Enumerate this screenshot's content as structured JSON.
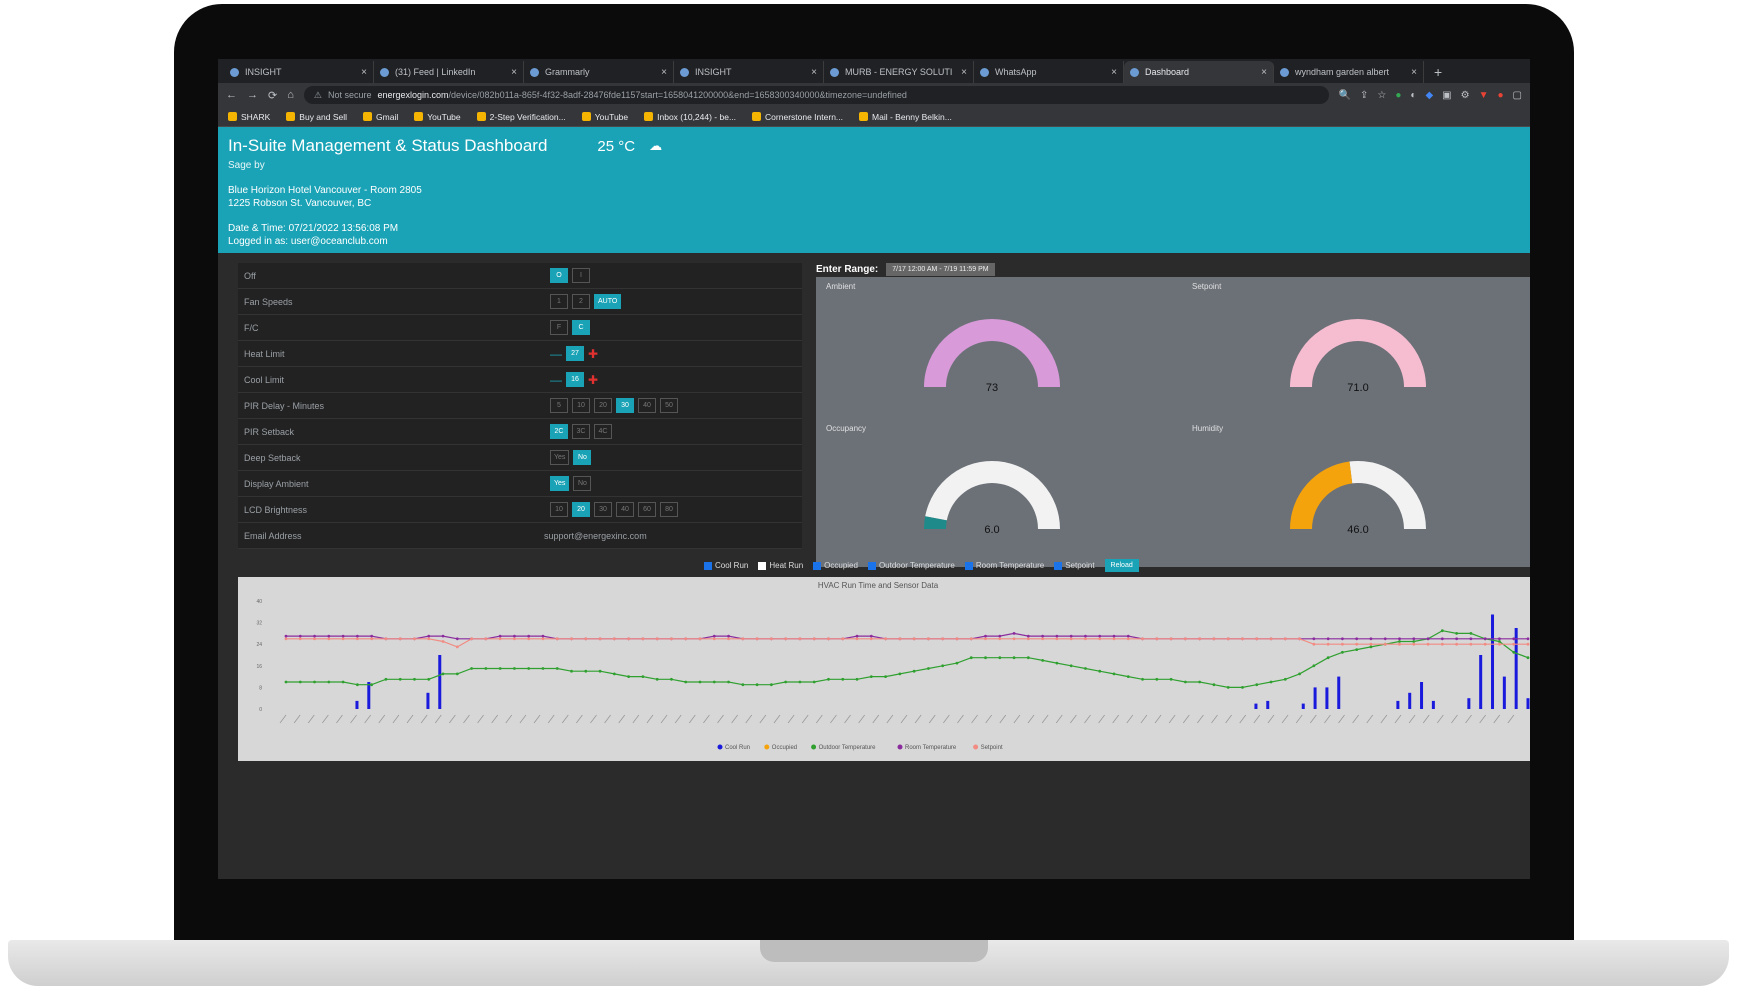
{
  "browser": {
    "tabs": [
      {
        "title": "INSIGHT",
        "active": false
      },
      {
        "title": "(31) Feed | LinkedIn",
        "active": false
      },
      {
        "title": "Grammarly",
        "active": false
      },
      {
        "title": "INSIGHT",
        "active": false
      },
      {
        "title": "MURB - ENERGY SOLUTI",
        "active": false
      },
      {
        "title": "WhatsApp",
        "active": false
      },
      {
        "title": "Dashboard",
        "active": true
      },
      {
        "title": "wyndham garden albert",
        "active": false
      }
    ],
    "new_tab": "+",
    "security": "Not secure",
    "url_host": "energexlogin.com",
    "url_path": "/device/082b011a-865f-4f32-8adf-28476fde1157start=1658041200000&end=1658300340000&timezone=undefined",
    "bookmarks": [
      "SHARK",
      "Buy and Sell",
      "Gmail",
      "YouTube",
      "2-Step Verification...",
      "YouTube",
      "Inbox (10,244) - be...",
      "Cornerstone Intern...",
      "Mail - Benny Belkin..."
    ]
  },
  "header": {
    "title": "In-Suite Management & Status Dashboard",
    "temperature": "25 °C",
    "sage_by": "Sage by",
    "hotel": "Blue Horizon Hotel Vancouver - Room 2805",
    "address": "1225 Robson St. Vancouver, BC",
    "datetime": "Date & Time: 07/21/2022 13:56:08 PM",
    "logged_in": "Logged in as: user@oceanclub.com"
  },
  "controls": [
    {
      "label": "Off",
      "type": "options",
      "options": [
        "O",
        "I"
      ],
      "active": 0
    },
    {
      "label": "Fan Speeds",
      "type": "options",
      "options": [
        "1",
        "2",
        "AUTO"
      ],
      "active": 2
    },
    {
      "label": "F/C",
      "type": "options",
      "options": [
        "F",
        "C"
      ],
      "active": 1
    },
    {
      "label": "Heat Limit",
      "type": "stepper",
      "value": "27"
    },
    {
      "label": "Cool Limit",
      "type": "stepper",
      "value": "16"
    },
    {
      "label": "PIR Delay - Minutes",
      "type": "options",
      "options": [
        "5",
        "10",
        "20",
        "30",
        "40",
        "50"
      ],
      "active": 3
    },
    {
      "label": "PIR Setback",
      "type": "options",
      "options": [
        "2C",
        "3C",
        "4C"
      ],
      "active": 0
    },
    {
      "label": "Deep Setback",
      "type": "options",
      "options": [
        "Yes",
        "No"
      ],
      "active": 1
    },
    {
      "label": "Display Ambient",
      "type": "options",
      "options": [
        "Yes",
        "No"
      ],
      "active": 0
    },
    {
      "label": "LCD Brightness",
      "type": "options",
      "options": [
        "10",
        "20",
        "30",
        "40",
        "60",
        "80"
      ],
      "active": 1
    },
    {
      "label": "Email Address",
      "type": "text",
      "value": "support@energexinc.com"
    }
  ],
  "range": {
    "label": "Enter Range:",
    "value": "7/17 12:00 AM - 7/19 11:59 PM"
  },
  "gauges": [
    {
      "title": "Ambient",
      "value": "73",
      "fraction": 1.0,
      "color": "#d89ad9"
    },
    {
      "title": "Setpoint",
      "value": "71.0",
      "fraction": 1.0,
      "color": "#f6bcd0"
    },
    {
      "title": "Occupancy",
      "value": "6.0",
      "fraction": 0.06,
      "color": "#1f8a8a"
    },
    {
      "title": "Humidity",
      "value": "46.0",
      "fraction": 0.46,
      "color": "#f5a30d"
    }
  ],
  "filters": {
    "items": [
      {
        "label": "Cool Run",
        "checked": true
      },
      {
        "label": "Heat Run",
        "checked": false
      },
      {
        "label": "Occupied",
        "checked": true
      },
      {
        "label": "Outdoor Temperature",
        "checked": true
      },
      {
        "label": "Room Temperature",
        "checked": true
      },
      {
        "label": "Setpoint",
        "checked": true
      }
    ],
    "reload": "Reload"
  },
  "chart_data": {
    "type": "line",
    "title": "HVAC Run Time and Sensor Data",
    "ylim": [
      0,
      40
    ],
    "yticks": [
      0,
      8,
      16,
      24,
      32,
      40
    ],
    "series": [
      {
        "name": "Cool Run",
        "type": "bar",
        "color": "#1a1adc",
        "values": [
          0,
          0,
          0,
          0,
          0,
          0,
          3,
          10,
          0,
          0,
          0,
          0,
          6,
          20,
          0,
          0,
          0,
          0,
          0,
          0,
          0,
          0,
          0,
          0,
          0,
          0,
          0,
          0,
          0,
          0,
          0,
          0,
          0,
          0,
          0,
          0,
          0,
          0,
          0,
          0,
          0,
          0,
          0,
          0,
          0,
          0,
          0,
          0,
          0,
          0,
          0,
          0,
          0,
          0,
          0,
          0,
          0,
          0,
          0,
          0,
          0,
          0,
          0,
          0,
          0,
          0,
          0,
          0,
          0,
          0,
          0,
          0,
          0,
          0,
          0,
          0,
          0,
          0,
          0,
          0,
          0,
          0,
          2,
          3,
          0,
          0,
          2,
          8,
          8,
          12,
          0,
          0,
          0,
          0,
          3,
          6,
          10,
          3,
          0,
          0,
          4,
          20,
          35,
          12,
          30,
          4
        ]
      },
      {
        "name": "Occupied",
        "type": "bar",
        "color": "#f5a30d",
        "values": [
          0,
          0,
          0,
          0,
          0,
          0,
          0,
          0,
          0,
          0,
          0,
          0,
          0,
          0,
          0,
          0,
          0,
          0,
          0,
          0,
          0,
          0,
          0,
          0,
          0,
          0,
          0,
          0,
          0,
          0,
          0,
          0,
          0,
          0,
          0,
          0,
          0,
          0,
          0,
          0,
          0,
          0,
          0,
          0,
          0,
          0,
          0,
          0,
          0,
          0,
          0,
          0,
          0,
          0,
          0,
          0,
          0,
          0,
          0,
          0,
          0,
          0,
          0,
          0,
          0,
          0,
          0,
          0,
          0,
          0,
          0,
          0,
          0,
          0,
          0,
          0,
          0,
          0,
          0,
          0,
          0,
          0,
          0,
          0,
          0,
          0,
          0,
          0,
          0,
          0,
          0,
          0,
          0,
          0,
          0,
          0,
          0,
          0,
          0,
          0,
          0,
          0,
          0,
          0,
          0,
          0
        ]
      },
      {
        "name": "Outdoor Temperature",
        "type": "line",
        "color": "#2fa02f",
        "values": [
          10,
          10,
          10,
          10,
          10,
          9,
          9,
          11,
          11,
          11,
          11,
          13,
          13,
          15,
          15,
          15,
          15,
          15,
          15,
          15,
          14,
          14,
          14,
          13,
          12,
          12,
          11,
          11,
          10,
          10,
          10,
          10,
          9,
          9,
          9,
          10,
          10,
          10,
          11,
          11,
          11,
          12,
          12,
          13,
          14,
          15,
          16,
          17,
          19,
          19,
          19,
          19,
          19,
          18,
          17,
          16,
          15,
          14,
          13,
          12,
          11,
          11,
          11,
          10,
          10,
          9,
          8,
          8,
          9,
          10,
          11,
          13,
          16,
          19,
          21,
          22,
          23,
          24,
          25,
          25,
          26,
          29,
          28,
          28,
          26,
          25,
          21,
          19
        ]
      },
      {
        "name": "Room Temperature",
        "type": "line",
        "color": "#8a2b9e",
        "values": [
          27,
          27,
          27,
          27,
          27,
          27,
          27,
          26,
          26,
          26,
          27,
          27,
          26,
          26,
          26,
          27,
          27,
          27,
          27,
          26,
          26,
          26,
          26,
          26,
          26,
          26,
          26,
          26,
          26,
          26,
          27,
          27,
          26,
          26,
          26,
          26,
          26,
          26,
          26,
          26,
          27,
          27,
          26,
          26,
          26,
          26,
          26,
          26,
          26,
          27,
          27,
          28,
          27,
          27,
          27,
          27,
          27,
          27,
          27,
          27,
          26,
          26,
          26,
          26,
          26,
          26,
          26,
          26,
          26,
          26,
          26,
          26,
          26,
          26,
          26,
          26,
          26,
          26,
          26,
          26,
          26,
          26,
          26,
          26,
          26,
          26,
          26,
          26
        ]
      },
      {
        "name": "Setpoint",
        "type": "line",
        "color": "#f28b82",
        "values": [
          26,
          26,
          26,
          26,
          26,
          26,
          26,
          26,
          26,
          26,
          26,
          25,
          23,
          26,
          26,
          26,
          26,
          26,
          26,
          26,
          26,
          26,
          26,
          26,
          26,
          26,
          26,
          26,
          26,
          26,
          26,
          26,
          26,
          26,
          26,
          26,
          26,
          26,
          26,
          26,
          26,
          26,
          26,
          26,
          26,
          26,
          26,
          26,
          26,
          26,
          26,
          26,
          26,
          26,
          26,
          26,
          26,
          26,
          26,
          26,
          26,
          26,
          26,
          26,
          26,
          26,
          26,
          26,
          26,
          26,
          26,
          26,
          24,
          24,
          24,
          24,
          24,
          24,
          24,
          24,
          24,
          24,
          24,
          24,
          24,
          24,
          24,
          24
        ]
      }
    ],
    "legend": "bottom"
  }
}
